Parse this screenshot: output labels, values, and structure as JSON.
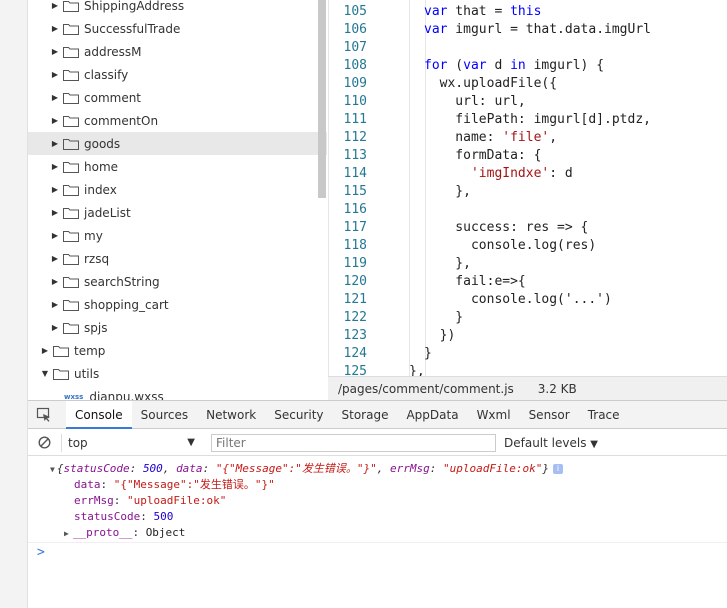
{
  "tree": {
    "items": [
      {
        "label": "ShippingAddress",
        "expanded": false
      },
      {
        "label": "SuccessfulTrade",
        "expanded": false
      },
      {
        "label": "addressM",
        "expanded": false
      },
      {
        "label": "classify",
        "expanded": false
      },
      {
        "label": "comment",
        "expanded": false
      },
      {
        "label": "commentOn",
        "expanded": false
      },
      {
        "label": "goods",
        "expanded": false,
        "selected": true
      },
      {
        "label": "home",
        "expanded": false
      },
      {
        "label": "index",
        "expanded": false
      },
      {
        "label": "jadeList",
        "expanded": false
      },
      {
        "label": "my",
        "expanded": false
      },
      {
        "label": "rzsq",
        "expanded": false
      },
      {
        "label": "searchString",
        "expanded": false
      },
      {
        "label": "shopping_cart",
        "expanded": false
      },
      {
        "label": "spjs",
        "expanded": false
      },
      {
        "label": "temp",
        "expanded": false
      },
      {
        "label": "utils",
        "expanded": true
      }
    ],
    "partial_file": {
      "tag": "wxss",
      "label": "dianpu.wxss"
    }
  },
  "editor": {
    "lines": [
      {
        "n": "105",
        "html": "<span class=\"kw\">var</span> that = <span class=\"kw\">this</span>"
      },
      {
        "n": "106",
        "html": "<span class=\"kw\">var</span> imgurl = that.data.imgUrl"
      },
      {
        "n": "107",
        "html": ""
      },
      {
        "n": "108",
        "html": "<span class=\"kw\">for</span> (<span class=\"kw\">var</span> d <span class=\"kw\">in</span> imgurl) {"
      },
      {
        "n": "109",
        "html": "  wx.uploadFile({"
      },
      {
        "n": "110",
        "html": "    url: url,"
      },
      {
        "n": "111",
        "html": "    filePath: imgurl[d].ptdz,"
      },
      {
        "n": "112",
        "html": "    name: <span class=\"str\">'file'</span>,"
      },
      {
        "n": "113",
        "html": "    formData: {"
      },
      {
        "n": "114",
        "html": "      <span class=\"str\">'imgIndxe'</span>: d"
      },
      {
        "n": "115",
        "html": "    },"
      },
      {
        "n": "116",
        "html": ""
      },
      {
        "n": "117",
        "html": "    success: res => {"
      },
      {
        "n": "118",
        "html": "      console.log(res)"
      },
      {
        "n": "119",
        "html": "    },"
      },
      {
        "n": "120",
        "html": "    fail:e=>{"
      },
      {
        "n": "121",
        "html": "      console.log('...')"
      },
      {
        "n": "122",
        "html": "    }"
      },
      {
        "n": "123",
        "html": "  })"
      },
      {
        "n": "124",
        "html": "}"
      },
      {
        "n": "125",
        "html": "},"
      }
    ]
  },
  "status": {
    "path": "/pages/comment/comment.js",
    "size": "3.2 KB"
  },
  "devtools": {
    "tabs": [
      "Console",
      "Sources",
      "Network",
      "Security",
      "Storage",
      "AppData",
      "Wxml",
      "Sensor",
      "Trace"
    ],
    "active_tab": "Console",
    "context": "top",
    "filter_placeholder": "Filter",
    "levels": "Default levels"
  },
  "console": {
    "summary": {
      "open": "{",
      "k1": "statusCode",
      "v1": "500",
      "k2": "data",
      "v2": "\"{\"Message\":\"发生错误。\"}\"",
      "k3": "errMsg",
      "v3": "\"uploadFile:ok\"",
      "close": "}"
    },
    "props": [
      {
        "key": "data",
        "value": "\"{\"Message\":\"发生错误。\"}\"",
        "kind": "str"
      },
      {
        "key": "errMsg",
        "value": "\"uploadFile:ok\"",
        "kind": "str"
      },
      {
        "key": "statusCode",
        "value": "500",
        "kind": "num"
      }
    ],
    "proto": {
      "key": "__proto__",
      "value": "Object"
    },
    "prompt": ">"
  },
  "colors": {
    "accent": "#3879d9",
    "keyword": "#0000ff",
    "string": "#a31515"
  }
}
